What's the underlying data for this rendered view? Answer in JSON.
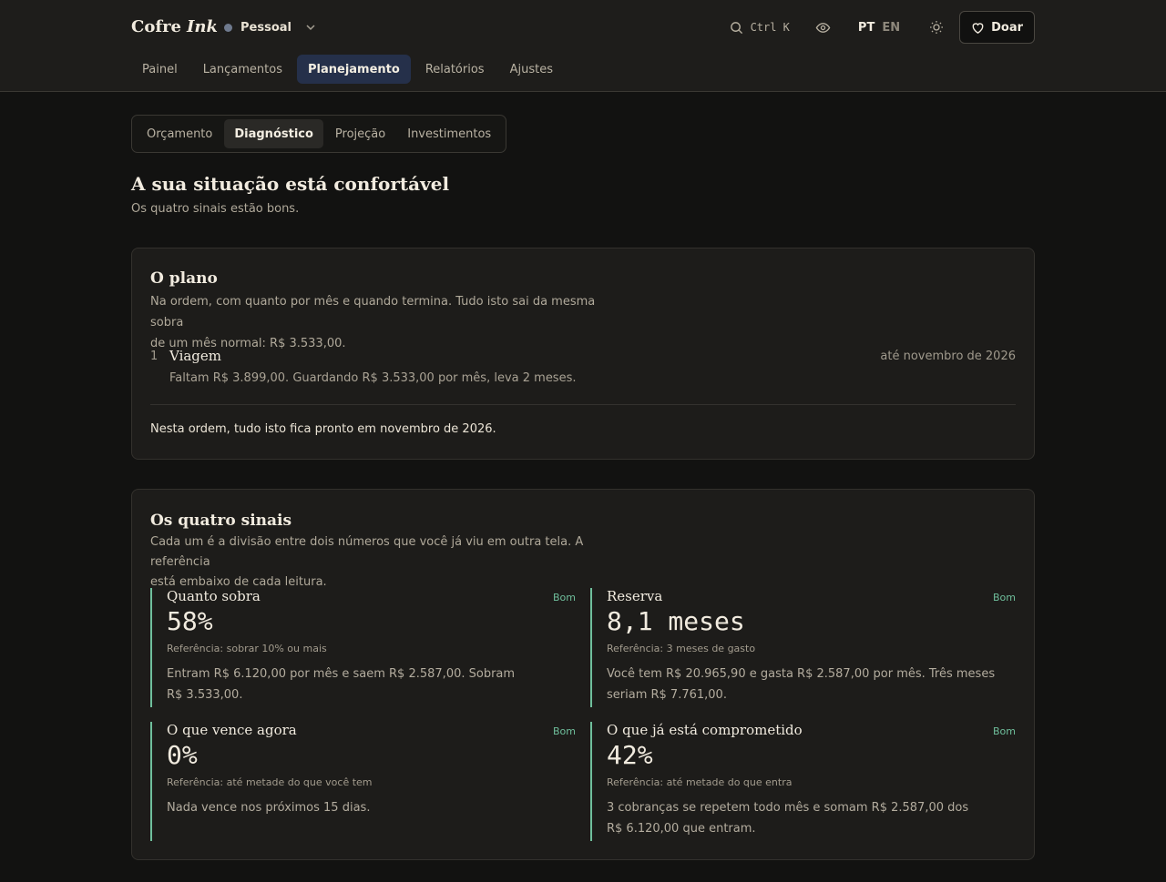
{
  "brand": {
    "name": "Cofre",
    "accent": "Ink"
  },
  "workspace": {
    "name": "Pessoal"
  },
  "search": {
    "shortcut": "Ctrl K"
  },
  "lang": {
    "pt": "PT",
    "en": "EN"
  },
  "donate": {
    "label": "Doar"
  },
  "nav": {
    "tabs": [
      "Painel",
      "Lançamentos",
      "Planejamento",
      "Relatórios",
      "Ajustes"
    ],
    "active": "Planejamento"
  },
  "subnav": {
    "tabs": [
      "Orçamento",
      "Diagnóstico",
      "Projeção",
      "Investimentos"
    ],
    "active": "Diagnóstico"
  },
  "page": {
    "title": "A sua situação está confortável",
    "subtitle": "Os quatro sinais estão bons."
  },
  "plan": {
    "title": "O plano",
    "desc_line1": "Na ordem, com quanto por mês e quando termina. Tudo isto sai da mesma sobra",
    "desc_line2": "de um mês normal: R$ 3.533,00.",
    "items": [
      {
        "num": "1",
        "name": "Viagem",
        "date": "até novembro de 2026",
        "detail": "Faltam R$ 3.899,00. Guardando R$ 3.533,00 por mês, leva 2 meses."
      }
    ],
    "summary": "Nesta ordem, tudo isto fica pronto em novembro de 2026."
  },
  "signals": {
    "title": "Os quatro sinais",
    "desc_line1": "Cada um é a divisão entre dois números que você já viu em outra tela. A referência",
    "desc_line2": "está embaixo de cada leitura.",
    "items": [
      {
        "title": "Quanto sobra",
        "badge": "Bom",
        "value": "58%",
        "ref": "Referência: sobrar 10% ou mais",
        "body_line1": "Entram R$ 6.120,00 por mês e saem R$ 2.587,00. Sobram",
        "body_line2": "R$ 3.533,00."
      },
      {
        "title": "Reserva",
        "badge": "Bom",
        "value": "8,1 meses",
        "ref": "Referência: 3 meses de gasto",
        "body_line1": "Você tem R$ 20.965,90 e gasta R$ 2.587,00 por mês. Três meses",
        "body_line2": "seriam R$ 7.761,00."
      },
      {
        "title": "O que vence agora",
        "badge": "Bom",
        "value": "0%",
        "ref": "Referência: até metade do que você tem",
        "body_line1": "Nada vence nos próximos 15 dias.",
        "body_line2": ""
      },
      {
        "title": "O que já está comprometido",
        "badge": "Bom",
        "value": "42%",
        "ref": "Referência: até metade do que entra",
        "body_line1": "3 cobranças se repetem todo mês e somam R$ 2.587,00 dos",
        "body_line2": "R$ 6.120,00 que entram."
      }
    ]
  },
  "colors": {
    "accent_green": "#6fbf9c",
    "active_tab": "#25304a",
    "background": "#121211"
  },
  "icons": {
    "search": "search-icon",
    "eye": "eye-icon",
    "sun": "sun-icon",
    "heart": "heart-icon",
    "chevron": "chevron-down-icon"
  }
}
